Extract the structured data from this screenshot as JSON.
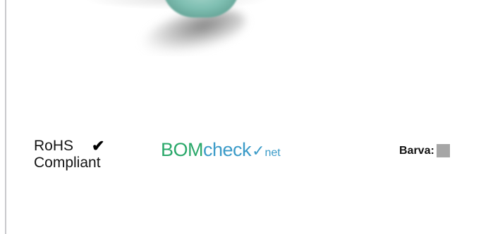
{
  "rohs": {
    "line1": "RoHS",
    "line2": "Compliant",
    "check_glyph": "✔"
  },
  "bomcheck": {
    "part_bom": "BOM",
    "part_check": "check",
    "tick_glyph": "✓",
    "part_net": "net",
    "icon_name": "bomcheck-logo"
  },
  "color_field": {
    "label": "Barva:",
    "swatch_color": "#a6a6a6"
  },
  "colors": {
    "bomcheck_green": "#2aa86a",
    "bomcheck_blue": "#3b9bc8",
    "product_teal": "#7fbfb2"
  }
}
